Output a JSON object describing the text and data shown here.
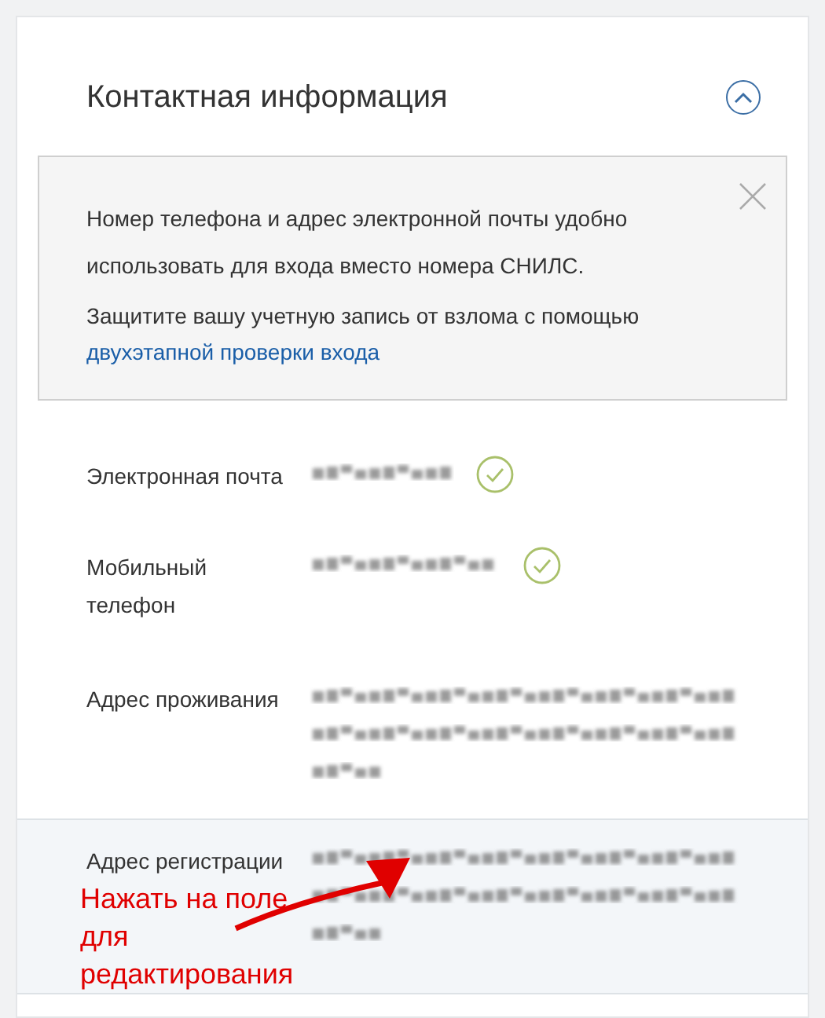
{
  "section": {
    "title": "Контактная информация",
    "expanded": true
  },
  "notice": {
    "lines": [
      "Номер телефона и адрес электронной почты удобно",
      "использовать для входа вместо номера СНИЛС.",
      "Защитите вашу учетную запись от взлома с помощью"
    ],
    "link": "двухэтапной проверки входа"
  },
  "fields": [
    {
      "label": "Электронная почта",
      "verified": true,
      "selected": false
    },
    {
      "label": "Мобильный телефон",
      "verified": true,
      "selected": false
    },
    {
      "label": "Адрес проживания",
      "verified": false,
      "selected": false
    },
    {
      "label": "Адрес регистрации",
      "verified": false,
      "selected": true
    }
  ],
  "annotation": {
    "text": "Нажать на поле для редактирования"
  }
}
